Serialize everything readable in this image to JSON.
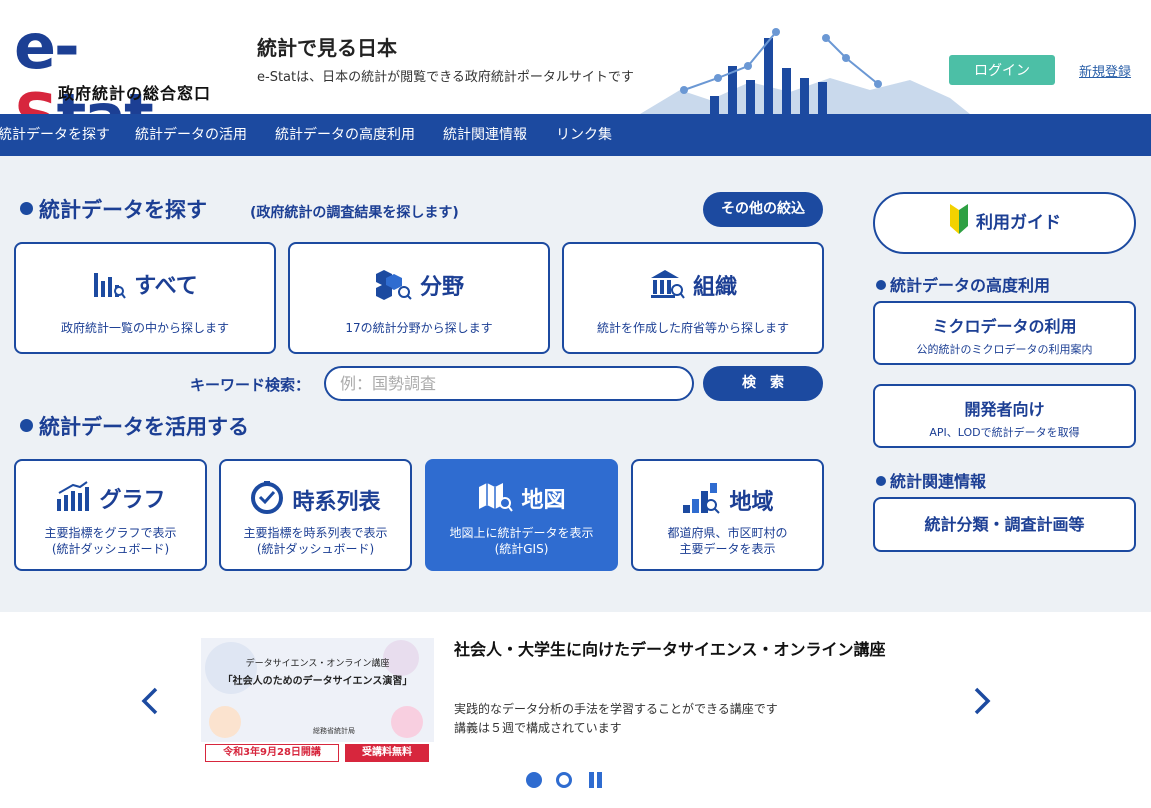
{
  "header": {
    "logo_text_1": "e-",
    "logo_text_2": "S",
    "logo_text_3": "tat",
    "logo_subtitle": "政府統計の総合窓口",
    "tagline_title": "統計で見る日本",
    "tagline_sub": "e-Statは、日本の統計が閲覧できる政府統計ポータルサイトです",
    "login_label": "ログイン",
    "register_label": "新規登録"
  },
  "nav": {
    "items": [
      "統計データを探す",
      "統計データの活用",
      "統計データの高度利用",
      "統計関連情報",
      "リンク集"
    ]
  },
  "search_section": {
    "title": "統計データを探す",
    "note": "(政府統計の調査結果を探します)",
    "filter_button": "その他の絞込",
    "cards": [
      {
        "title": "すべて",
        "desc": "政府統計一覧の中から探します",
        "icon": "bar-chart-search-icon"
      },
      {
        "title": "分野",
        "desc": "17の統計分野から探します",
        "icon": "cubes-search-icon"
      },
      {
        "title": "組織",
        "desc": "統計を作成した府省等から探します",
        "icon": "building-search-icon"
      }
    ],
    "keyword_label": "キーワード検索：",
    "keyword_placeholder": "例：国勢調査",
    "search_button": "検　索"
  },
  "use_section": {
    "title": "統計データを活用する",
    "cards": [
      {
        "title": "グラフ",
        "desc1": "主要指標をグラフで表示",
        "desc2": "(統計ダッシュボード)",
        "icon": "graph-icon"
      },
      {
        "title": "時系列表",
        "desc1": "主要指標を時系列表で表示",
        "desc2": "(統計ダッシュボード)",
        "icon": "clock-icon"
      },
      {
        "title": "地図",
        "desc1": "地図上に統計データを表示",
        "desc2": "(統計GIS)",
        "icon": "map-search-icon"
      },
      {
        "title": "地域",
        "desc1": "都道府県、市区町村の",
        "desc2": "主要データを表示",
        "icon": "region-bars-icon"
      }
    ]
  },
  "sidebar": {
    "guide_label": "利用ガイド",
    "advanced_title": "統計データの高度利用",
    "micro_title": "ミクロデータの利用",
    "micro_sub": "公的統計のミクロデータの利用案内",
    "dev_title": "開発者向け",
    "dev_sub": "API、LODで統計データを取得",
    "related_title": "統計関連情報",
    "classification_title": "統計分類・調査計画等"
  },
  "carousel": {
    "banner_line1": "データサイエンス・オンライン講座",
    "banner_line2": "「社会人のためのデータサイエンス演習」",
    "banner_org": "総務省統計局",
    "banner_date": "令和3年9月28日開講",
    "banner_free": "受講料無料",
    "news_title": "社会人・大学生に向けたデータサイエンス・オンライン講座",
    "news_desc1": "実践的なデータ分析の手法を学習することができる講座です",
    "news_desc2": "講義は５週で構成されています"
  },
  "colors": {
    "primary": "#1c4aa0",
    "accent_red": "#d7263d",
    "login_green": "#4cbfa6",
    "active_card": "#2f6cd0",
    "main_bg": "#edf1f5"
  }
}
